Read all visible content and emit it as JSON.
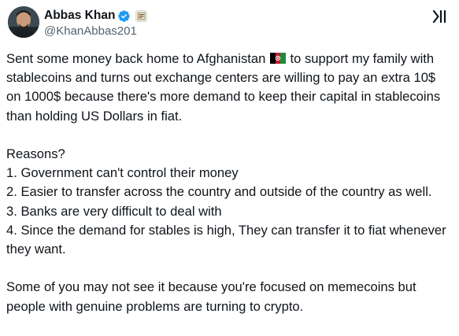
{
  "author": {
    "display_name": "Abbas Khan",
    "handle": "@KhanAbbas201",
    "verified_icon": "verified-badge-icon",
    "affiliate_icon": "affiliate-badge-icon"
  },
  "grok_icon": "grok-icon",
  "tweet": {
    "para1_a": "Sent some money back home to Afghanistan",
    "para1_b": " to support my family with stablecoins and turns out exchange centers are willing to pay an extra 10$ on 1000$ because there's more demand to keep their capital in stablecoins than holding US Dollars in fiat.",
    "reasons_heading": "Reasons?",
    "reasons": [
      "1. Government can't control their money",
      "2. Easier to transfer across the country and outside of the country as well.",
      "3. Banks are very difficult to deal with",
      "4. Since the demand for stables is high, They can transfer it to fiat whenever they want."
    ],
    "closing": "Some of you may not see it because you're focused on memecoins but people with genuine problems are turning to crypto."
  },
  "colors": {
    "text": "#0f1419",
    "secondary": "#536471",
    "verified": "#1d9bf0"
  }
}
